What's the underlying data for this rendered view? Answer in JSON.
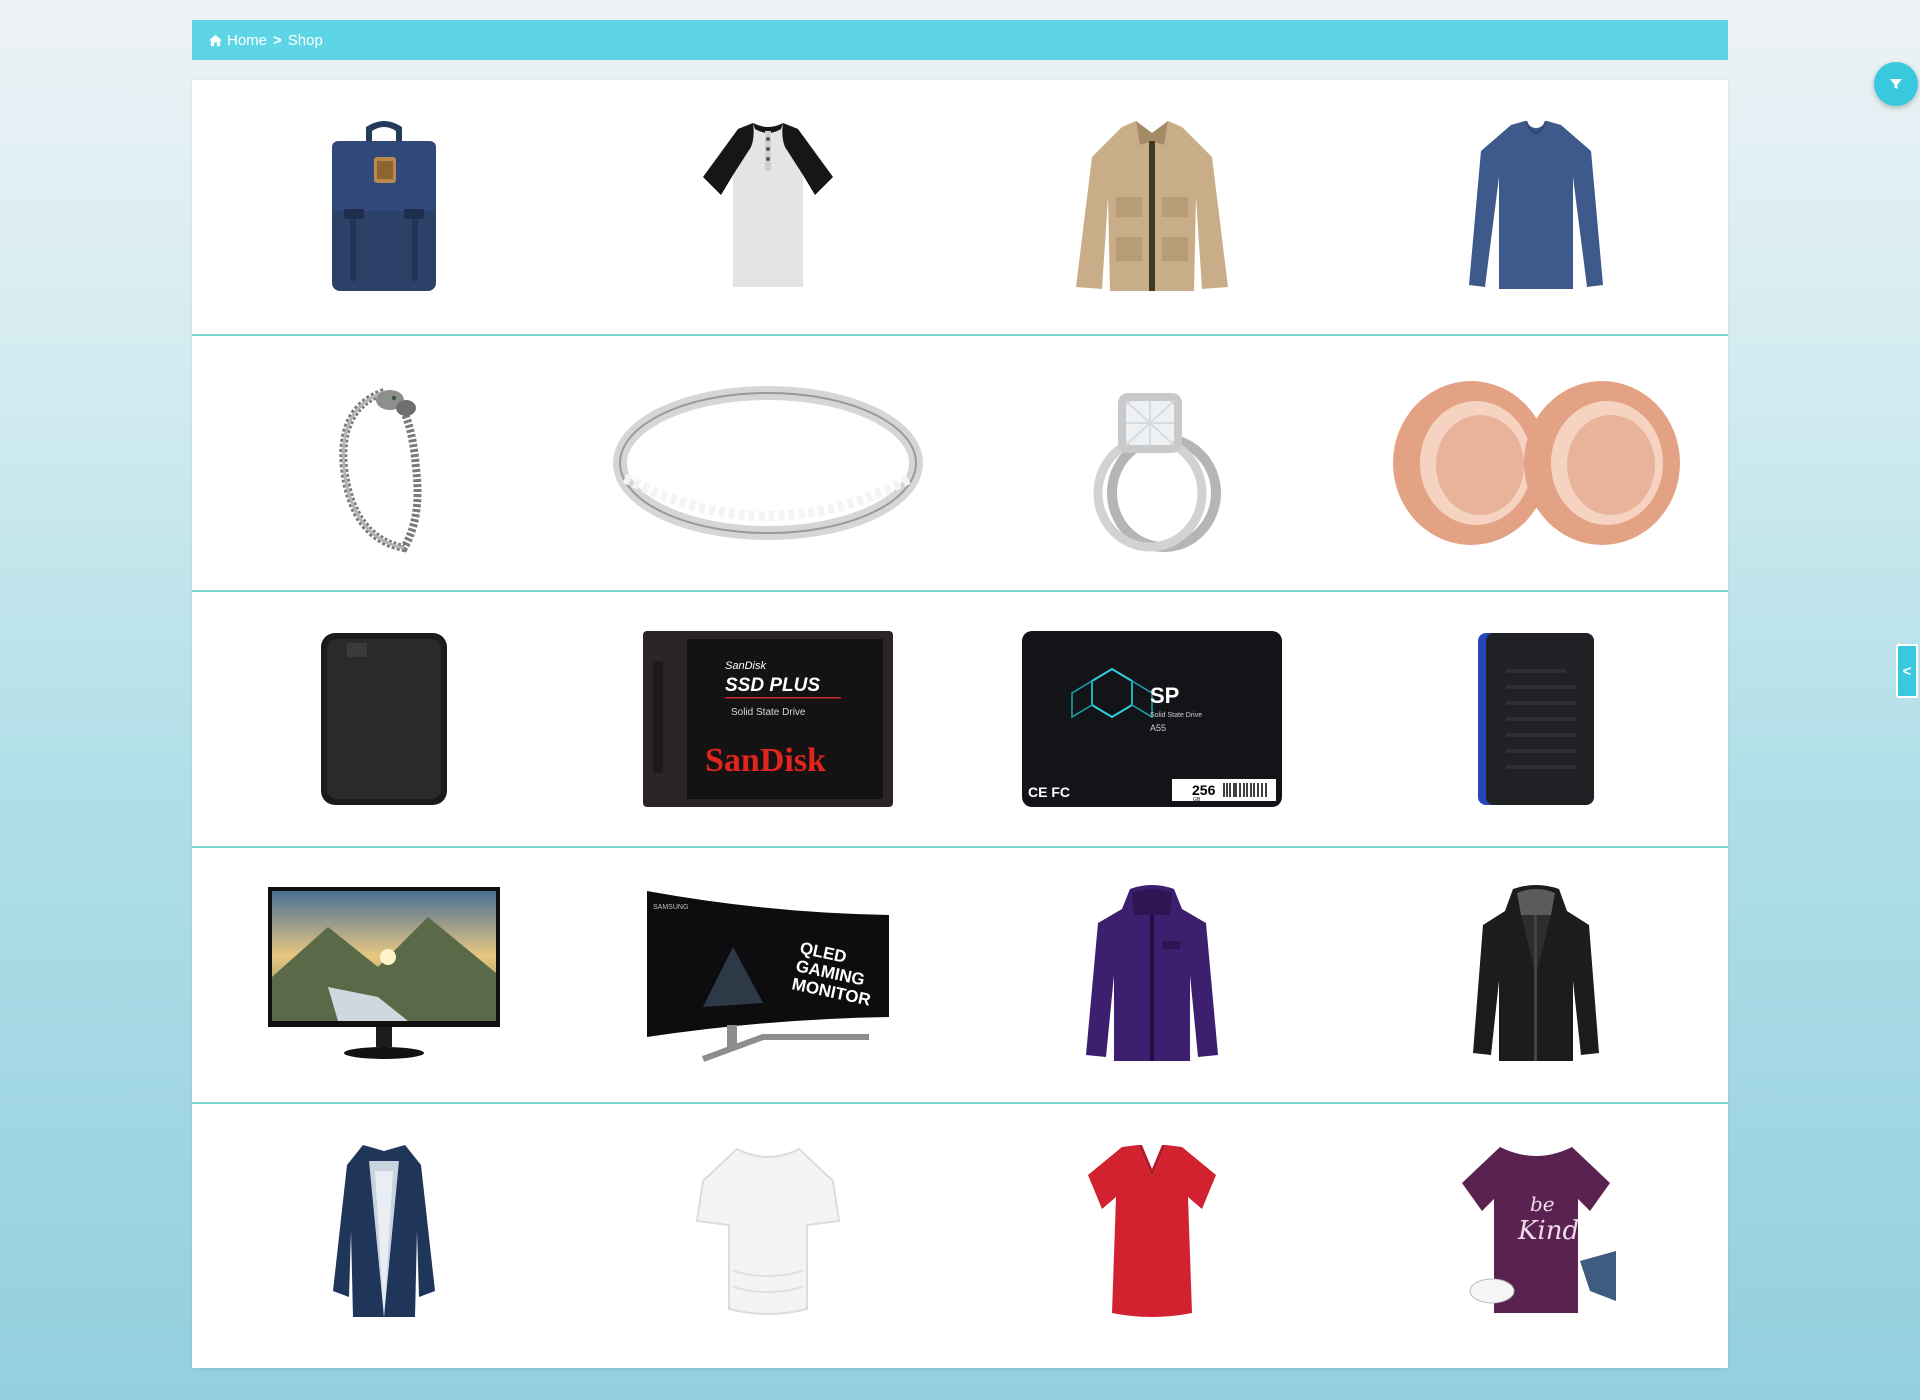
{
  "breadcrumb": {
    "home": "Home",
    "separator": ">",
    "current": "Shop"
  },
  "side_tab": {
    "label": "<"
  },
  "products": [
    [
      "backpack",
      "henley-shirt",
      "field-jacket",
      "long-sleeve-tee"
    ],
    [
      "bracelet",
      "eternity-ring",
      "halo-ring-set",
      "ear-tunnels"
    ],
    [
      "portable-hard-drive",
      "sandisk-ssd",
      "silicon-power-ssd",
      "gaming-drive"
    ],
    [
      "monitor",
      "curved-gaming-monitor",
      "purple-jacket",
      "leather-jacket"
    ],
    [
      "trench-coat",
      "white-top",
      "red-vneck",
      "be-kind-tee"
    ]
  ],
  "product_text": {
    "sandisk_line1": "SanDisk",
    "sandisk_line2": "SSD PLUS",
    "sandisk_line3": "Solid State Drive",
    "sandisk_brand": "SanDisk",
    "sp_logo": "SP",
    "sp_line1": "Solid State Drive",
    "sp_model": "A55",
    "sp_capacity": "256",
    "sp_unit": "GB",
    "sp_marks": "CE FC",
    "qled_text1": "QLED",
    "qled_text2": "GAMING",
    "qled_text3": "MONITOR",
    "samsung": "SAMSUNG",
    "bekind_1": "be",
    "bekind_2": "Kind"
  },
  "colors": {
    "accent": "#5ed5e6",
    "row_divider": "#7dd4cd",
    "fab": "#39c9df"
  }
}
